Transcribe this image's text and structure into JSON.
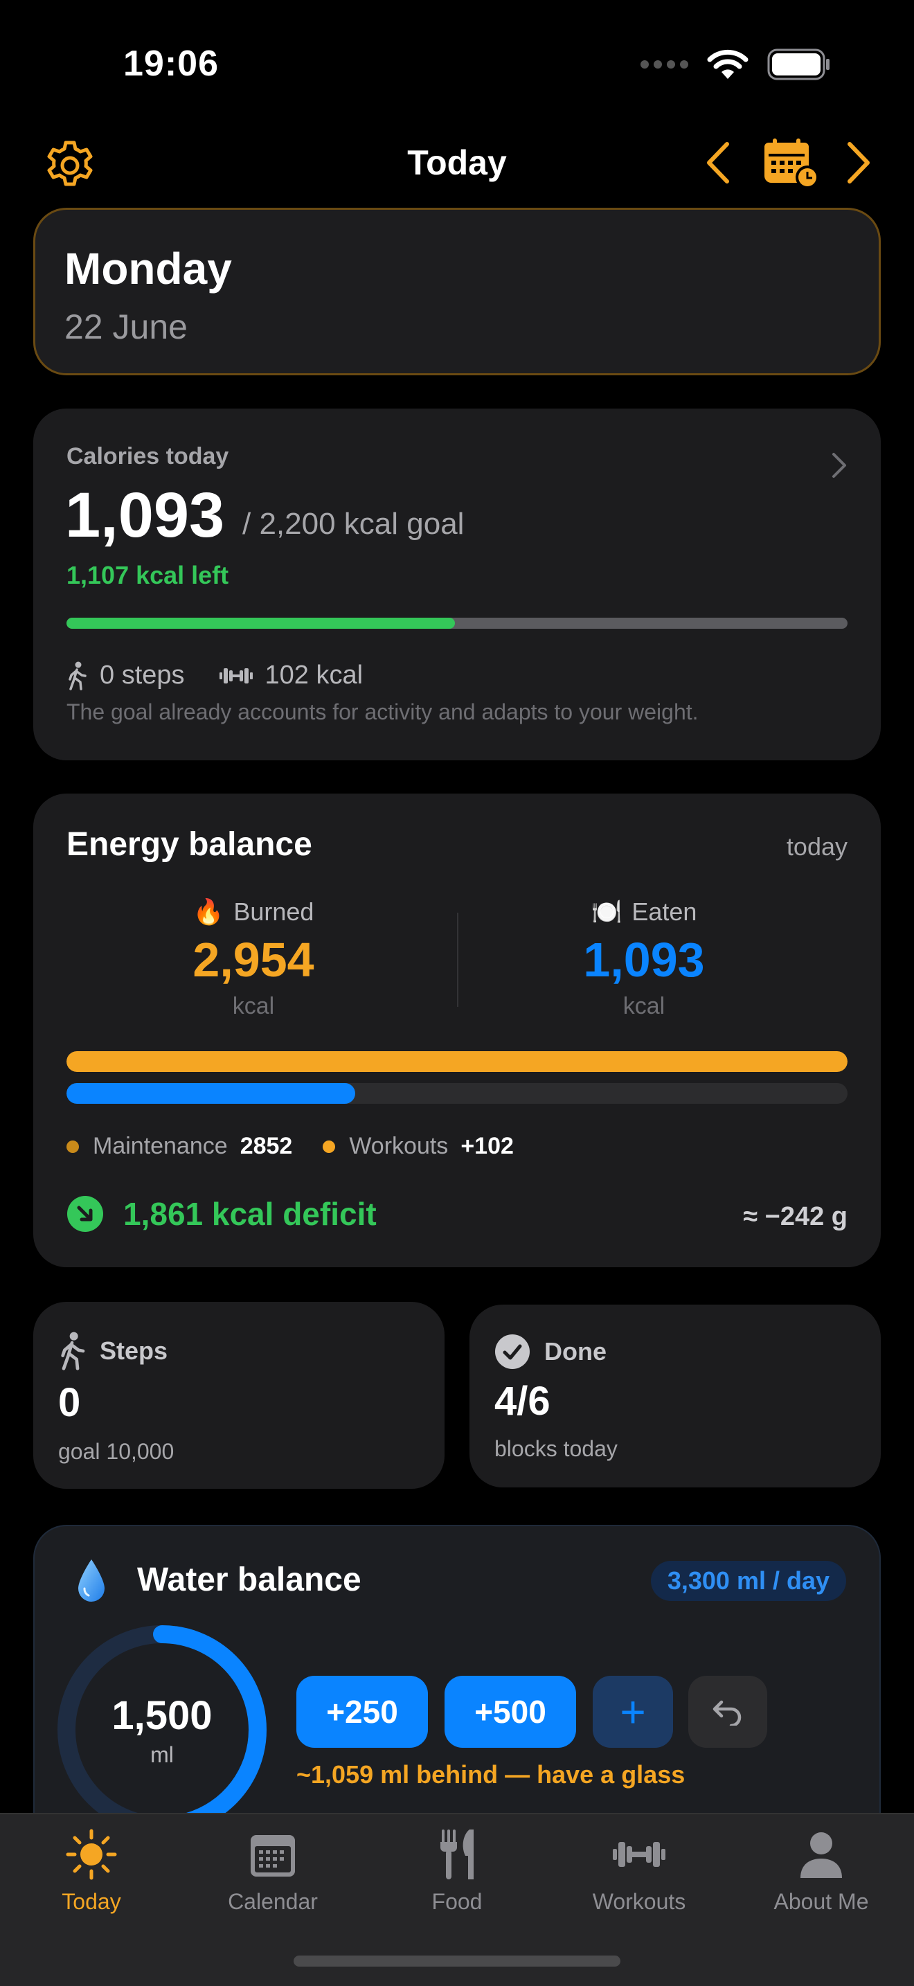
{
  "status_bar": {
    "time": "19:06"
  },
  "nav": {
    "title": "Today"
  },
  "date_card": {
    "day": "Monday",
    "date": "22 June"
  },
  "calories": {
    "label": "Calories today",
    "value": "1,093",
    "goal_text": "/ 2,200 kcal goal",
    "left_text": "1,107 kcal left",
    "progress_fraction": 0.497,
    "steps_text": "0 steps",
    "active_text": "102 kcal",
    "note": "The goal already accounts for activity and adapts to your weight."
  },
  "energy": {
    "title": "Energy balance",
    "period": "today",
    "burned": {
      "label": "Burned",
      "emoji": "🔥",
      "value": "2,954",
      "unit": "kcal"
    },
    "eaten": {
      "label": "Eaten",
      "emoji": "🍽️",
      "value": "1,093",
      "unit": "kcal"
    },
    "burned_fraction": 1.0,
    "eaten_fraction": 0.37,
    "legend": [
      {
        "label": "Maintenance",
        "value": "2852",
        "color": "#c98a1a"
      },
      {
        "label": "Workouts",
        "value": "+102",
        "color": "#f5a623"
      }
    ],
    "deficit_text": "1,861 kcal deficit",
    "grams_text": "≈ −242 g"
  },
  "steps_card": {
    "title": "Steps",
    "value": "0",
    "sub": "goal 10,000"
  },
  "done_card": {
    "title": "Done",
    "value": "4/6",
    "sub": "blocks today"
  },
  "water": {
    "title": "Water balance",
    "goal_badge": "3,300 ml / day",
    "value": "1,500",
    "unit": "ml",
    "fraction": 0.455,
    "buttons": {
      "add250": "+250",
      "add500": "+500",
      "custom": "+"
    },
    "message": "~1,059 ml behind — have a glass"
  },
  "tabs": [
    {
      "label": "Today",
      "icon": "sun-icon",
      "active": true
    },
    {
      "label": "Calendar",
      "icon": "calendar-icon",
      "active": false
    },
    {
      "label": "Food",
      "icon": "fork-knife-icon",
      "active": false
    },
    {
      "label": "Workouts",
      "icon": "dumbbell-icon",
      "active": false
    },
    {
      "label": "About Me",
      "icon": "person-icon",
      "active": false
    }
  ],
  "colors": {
    "accent": "#f5a623",
    "green": "#34c759",
    "blue": "#0a84ff",
    "card": "#1c1c1e"
  }
}
